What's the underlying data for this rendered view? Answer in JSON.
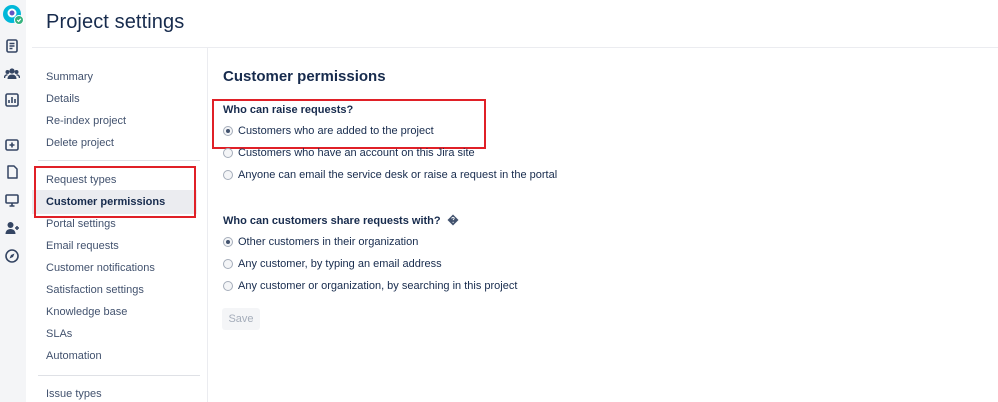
{
  "rail": {
    "icons": [
      "avatar",
      "queues-icon",
      "customers-icon",
      "reports-icon",
      "add-item-icon",
      "page-icon",
      "monitor-icon",
      "invite-team-icon",
      "compass-icon"
    ],
    "accent": "#00b8d9",
    "badge": "#36b37e"
  },
  "header": {
    "title": "Project settings"
  },
  "sidebar": {
    "items": [
      {
        "label": "Summary"
      },
      {
        "label": "Details"
      },
      {
        "label": "Re-index project"
      },
      {
        "label": "Delete project"
      },
      {
        "label": "Request types"
      },
      {
        "label": "Customer permissions",
        "active": true
      },
      {
        "label": "Portal settings"
      },
      {
        "label": "Email requests"
      },
      {
        "label": "Customer notifications"
      },
      {
        "label": "Satisfaction settings"
      },
      {
        "label": "Knowledge base"
      },
      {
        "label": "SLAs"
      },
      {
        "label": "Automation"
      },
      {
        "label": "Issue types"
      }
    ]
  },
  "main": {
    "title": "Customer permissions",
    "raise": {
      "question": "Who can raise requests?",
      "options": [
        {
          "label": "Customers who are added to the project",
          "checked": true
        },
        {
          "label": "Customers who have an account on this Jira site",
          "checked": false
        },
        {
          "label": "Anyone can email the service desk or raise a request in the portal",
          "checked": false
        }
      ]
    },
    "share": {
      "question": "Who can customers share requests with?",
      "options": [
        {
          "label": "Other customers in their organization",
          "checked": true
        },
        {
          "label": "Any customer, by typing an email address",
          "checked": false
        },
        {
          "label": "Any customer or organization, by searching in this project",
          "checked": false
        }
      ]
    },
    "save_label": "Save"
  },
  "highlight_color": "#e02027"
}
